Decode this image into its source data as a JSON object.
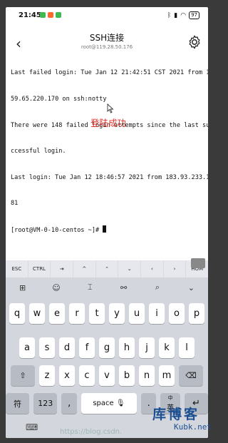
{
  "status_bar": {
    "time": "21:45",
    "battery": "97",
    "app_icon_colors": [
      "#3fb950",
      "#ff6a2b",
      "#3fb950"
    ]
  },
  "header": {
    "title": "SSH连接",
    "subtitle": "root@119.28.50.176"
  },
  "terminal": {
    "lines": [
      "Last failed login: Tue Jan 12 21:42:51 CST 2021 from 1",
      "59.65.220.170 on ssh:notty",
      "There were 148 failed login attempts since the last su",
      "ccessful login.",
      "Last login: Tue Jan 12 18:46:57 2021 from 183.93.233.1",
      "81"
    ],
    "prompt": "[root@VM-0-10-centos ~]# "
  },
  "annotation": "登陆成功",
  "extra_keys": [
    "ESC",
    "CTRL",
    "⇥",
    "^",
    "⌃",
    "⌄",
    "‹",
    "›",
    "HOM"
  ],
  "keyboard": {
    "toolbar_icons": [
      "grid-icon",
      "emoji-icon",
      "text-cursor-icon",
      "link-icon",
      "search-icon",
      "chevron-down-icon"
    ],
    "toolbar_glyphs": [
      "⊞",
      "☺",
      "⌶",
      "⚯",
      "⌕",
      "⌄"
    ],
    "row1": [
      "q",
      "w",
      "e",
      "r",
      "t",
      "y",
      "u",
      "i",
      "o",
      "p"
    ],
    "row2": [
      "a",
      "s",
      "d",
      "f",
      "g",
      "h",
      "j",
      "k",
      "l"
    ],
    "row3": [
      "z",
      "x",
      "c",
      "v",
      "b",
      "n",
      "m"
    ],
    "shift": "⇧",
    "backspace": "⌫",
    "symbols": "符",
    "numbers": "123",
    "comma": ",",
    "space": "space",
    "period": ".",
    "lang_top": "中",
    "lang_bottom": "英",
    "enter": "↵"
  },
  "watermark": "https://blog.csdn.",
  "brand": {
    "main": "库博客",
    "sub": "Kubk.net"
  }
}
